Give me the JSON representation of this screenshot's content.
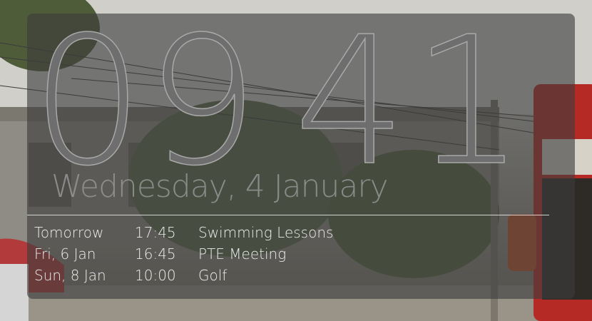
{
  "clock": {
    "digits": [
      "0",
      "9",
      "4",
      "1"
    ]
  },
  "date": {
    "label": "Wednesday, 4 January"
  },
  "events": [
    {
      "day": "Tomorrow",
      "time": "17:45",
      "title": "Swimming Lessons"
    },
    {
      "day": "Fri, 6 Jan",
      "time": "16:45",
      "title": "PTE Meeting"
    },
    {
      "day": "Sun, 8 Jan",
      "time": "10:00",
      "title": "Golf"
    }
  ],
  "colors": {
    "panel": "#3c3c3c",
    "digit_fill": "#6e6e6e",
    "digit_stroke": "#a9a9a9",
    "text": "#ececec",
    "date_text": "#969696"
  }
}
